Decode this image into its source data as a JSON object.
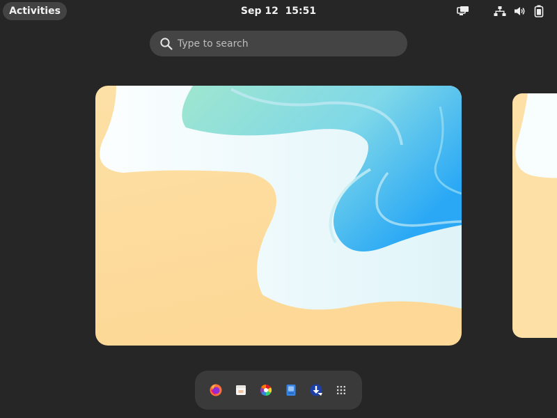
{
  "topbar": {
    "activities_label": "Activities",
    "clock": "Sep 12  15:51",
    "tray_icons": [
      "screen-share-icon",
      "network-icon",
      "volume-icon",
      "battery-icon"
    ]
  },
  "search": {
    "placeholder": "Type to search",
    "icon": "search-icon"
  },
  "workspaces": [
    {
      "name": "workspace-1",
      "wallpaper": "beach-waves"
    },
    {
      "name": "workspace-2",
      "wallpaper": "beach-waves"
    }
  ],
  "dash": {
    "apps": [
      {
        "name": "firefox",
        "icon": "firefox-icon"
      },
      {
        "name": "calendar",
        "icon": "calendar-icon"
      },
      {
        "name": "color-picker",
        "icon": "color-wheel-icon"
      },
      {
        "name": "notes",
        "icon": "notes-icon"
      },
      {
        "name": "software-installer",
        "icon": "software-installer-icon"
      },
      {
        "name": "show-apps",
        "icon": "app-grid-icon"
      }
    ]
  },
  "colors": {
    "background": "#262626",
    "panel": "#3a3a3a",
    "sand": "#fde2a9",
    "sea": "#35c0f0",
    "foam": "#f3fbfd"
  }
}
